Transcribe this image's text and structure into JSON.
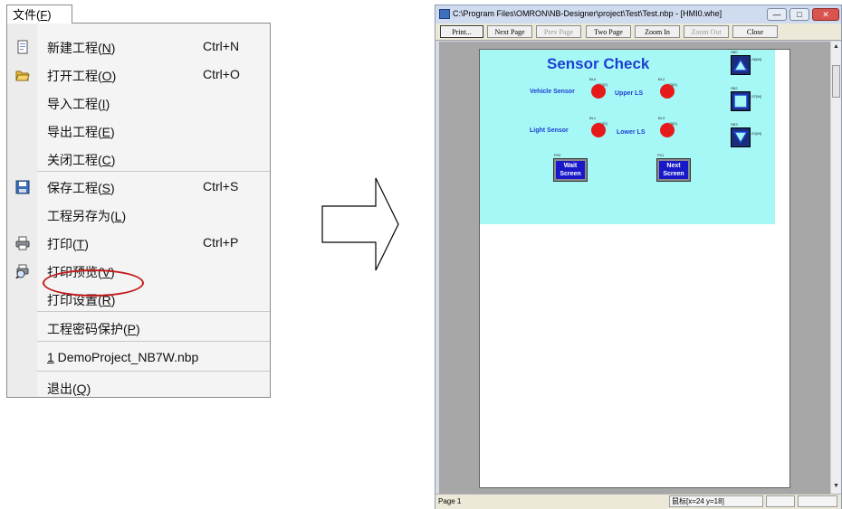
{
  "menu": {
    "title_text": "文件(",
    "title_key": "F",
    "title_end": ")",
    "items": [
      {
        "label": "新建工程(",
        "key": "N",
        "shortcut": "Ctrl+N",
        "icon": "new-project-icon"
      },
      {
        "label": "打开工程(",
        "key": "O",
        "shortcut": "Ctrl+O",
        "icon": "open-folder-icon"
      },
      {
        "label": "导入工程(",
        "key": "I",
        "shortcut": "",
        "icon": ""
      },
      {
        "label": "导出工程(",
        "key": "E",
        "shortcut": "",
        "icon": ""
      },
      {
        "label": "关闭工程(",
        "key": "C",
        "shortcut": "",
        "icon": ""
      },
      {
        "label": "保存工程(",
        "key": "S",
        "shortcut": "Ctrl+S",
        "icon": "save-disk-icon"
      },
      {
        "label": "工程另存为(",
        "key": "L",
        "shortcut": "",
        "icon": ""
      },
      {
        "label": "打印(",
        "key": "T",
        "shortcut": "Ctrl+P",
        "icon": "printer-icon"
      },
      {
        "label": "打印预览(",
        "key": "V",
        "shortcut": "",
        "icon": "print-preview-icon"
      },
      {
        "label": "打印设置(",
        "key": "R",
        "shortcut": "",
        "icon": ""
      },
      {
        "label": "工程密码保护(",
        "key": "P",
        "shortcut": "",
        "icon": ""
      },
      {
        "label": " DemoProject_NB7W.nbp",
        "key": "1",
        "shortcut": "",
        "icon": ""
      },
      {
        "label": "退出(",
        "key": "Q",
        "shortcut": "",
        "icon": ""
      }
    ]
  },
  "preview_window": {
    "title": "C:\\Program Files\\OMRON\\NB-Designer\\project\\Test\\Test.nbp - [HMI0.whe]",
    "toolbar": [
      {
        "label": "Print...",
        "disabled": false
      },
      {
        "label": "Next Page",
        "disabled": false
      },
      {
        "label": "Prev Page",
        "disabled": true
      },
      {
        "label": "Two Page",
        "disabled": false
      },
      {
        "label": "Zoom In",
        "disabled": false
      },
      {
        "label": "Zoom Out",
        "disabled": true
      },
      {
        "label": "Close",
        "disabled": false
      }
    ],
    "status_page": "Page 1",
    "status_coord": "鼠标[x=24  y=18]",
    "screen": {
      "title": "Sensor Check",
      "vehicle_sensor": "Vehicle Sensor",
      "light_sensor": "Light Sensor",
      "upper_ls": "Upper LS",
      "lower_ls": "Lower LS",
      "wait_screen": "Wait Screen",
      "next_screen": "Next Screen",
      "lamp_ids": [
        "BL0",
        "BL2",
        "BL1",
        "BL3"
      ],
      "lamp_addrs": [
        "LS1[0]",
        "LS5[0]",
        "LS4[0]",
        "LS6[0]"
      ],
      "func_ids": [
        "FK0",
        "FK1"
      ],
      "device_ids": [
        "SB0",
        "SB2",
        "SB3"
      ],
      "device_addrs": [
        "LS6[W]",
        "LS7[W]",
        "LS1[W]"
      ]
    },
    "colors": {
      "screen_bg": "#a6f8f7",
      "label_blue": "#1d3fd0",
      "lamp_red": "#e61a1a",
      "ellipse": "#c21a1a"
    }
  }
}
